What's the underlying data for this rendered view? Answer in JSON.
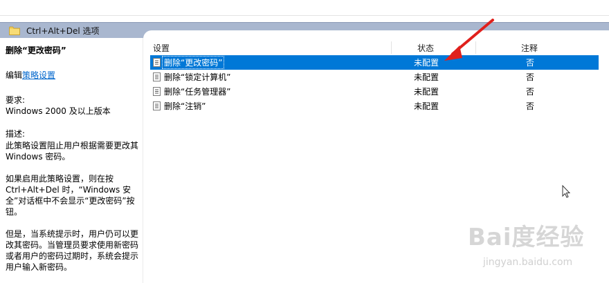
{
  "header": {
    "title": "Ctrl+Alt+Del 选项"
  },
  "details": {
    "policy_title": "删除“更改密码”",
    "edit_prefix": "编辑",
    "edit_link": "策略设置",
    "requirements_label": "要求:",
    "requirements_value": "Windows 2000 及以上版本",
    "description_label": "描述:",
    "paragraphs": [
      "此策略设置阻止用户根据需要更改其 Windows 密码。",
      "如果启用此策略设置，则在按 Ctrl+Alt+Del 时，“Windows 安全”对话框中不会显示“更改密码”按钮。",
      "但是，当系统提示时，用户仍可以更改其密码。当管理员要求使用新密码或者用户的密码过期时，系统会提示用户输入新密码。"
    ]
  },
  "list": {
    "columns": {
      "setting": "设置",
      "status": "状态",
      "note": "注释"
    },
    "rows": [
      {
        "name": "删除“更改密码”",
        "status": "未配置",
        "note": "否",
        "selected": true
      },
      {
        "name": "删除“锁定计算机”",
        "status": "未配置",
        "note": "否",
        "selected": false
      },
      {
        "name": "删除“任务管理器”",
        "status": "未配置",
        "note": "否",
        "selected": false
      },
      {
        "name": "删除“注销”",
        "status": "未配置",
        "note": "否",
        "selected": false
      }
    ]
  },
  "watermark": {
    "main": "Bai度经验",
    "sub": "jingyan.baidu.com"
  },
  "icons": {
    "header": "folder-icon",
    "row": "policy-doc-icon",
    "annotation": "red-arrow-icon",
    "pointer": "mouse-cursor-icon"
  },
  "colors": {
    "header_bar": "#a9b7cf",
    "selection": "#0078d7",
    "link": "#0066cc",
    "arrow": "#e0201c"
  }
}
